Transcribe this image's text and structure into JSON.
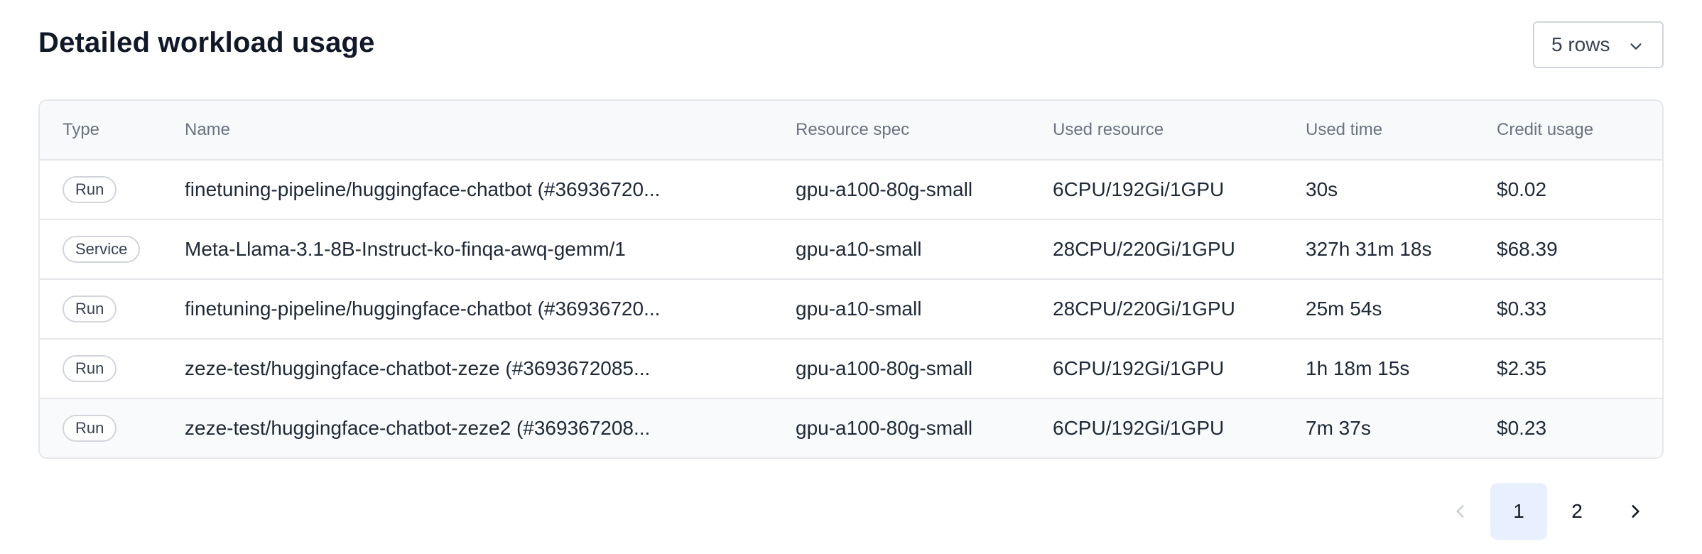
{
  "title": "Detailed workload usage",
  "rows_select": {
    "label": "5 rows"
  },
  "table": {
    "headers": [
      "Type",
      "Name",
      "Resource spec",
      "Used resource",
      "Used time",
      "Credit usage"
    ],
    "rows": [
      {
        "type": "Run",
        "name": "finetuning-pipeline/huggingface-chatbot (#36936720...",
        "spec": "gpu-a100-80g-small",
        "resource": "6CPU/192Gi/1GPU",
        "time": "30s",
        "credit": "$0.02"
      },
      {
        "type": "Service",
        "name": "Meta-Llama-3.1-8B-Instruct-ko-finqa-awq-gemm/1",
        "spec": "gpu-a10-small",
        "resource": "28CPU/220Gi/1GPU",
        "time": "327h 31m 18s",
        "credit": "$68.39"
      },
      {
        "type": "Run",
        "name": "finetuning-pipeline/huggingface-chatbot (#36936720...",
        "spec": "gpu-a10-small",
        "resource": "28CPU/220Gi/1GPU",
        "time": "25m 54s",
        "credit": "$0.33"
      },
      {
        "type": "Run",
        "name": "zeze-test/huggingface-chatbot-zeze (#3693672085...",
        "spec": "gpu-a100-80g-small",
        "resource": "6CPU/192Gi/1GPU",
        "time": "1h 18m 15s",
        "credit": "$2.35"
      },
      {
        "type": "Run",
        "name": "zeze-test/huggingface-chatbot-zeze2 (#369367208...",
        "spec": "gpu-a100-80g-small",
        "resource": "6CPU/192Gi/1GPU",
        "time": "7m 37s",
        "credit": "$0.23"
      }
    ]
  },
  "pagination": {
    "pages": [
      "1",
      "2"
    ],
    "current": "1"
  },
  "colors": {
    "accent_bg": "#e8efff",
    "border": "#e5e7eb",
    "header_bg": "#f8f9fb"
  },
  "icons": {
    "select": "chevron-down-icon",
    "prev": "chevron-left-icon",
    "next": "chevron-right-icon"
  }
}
